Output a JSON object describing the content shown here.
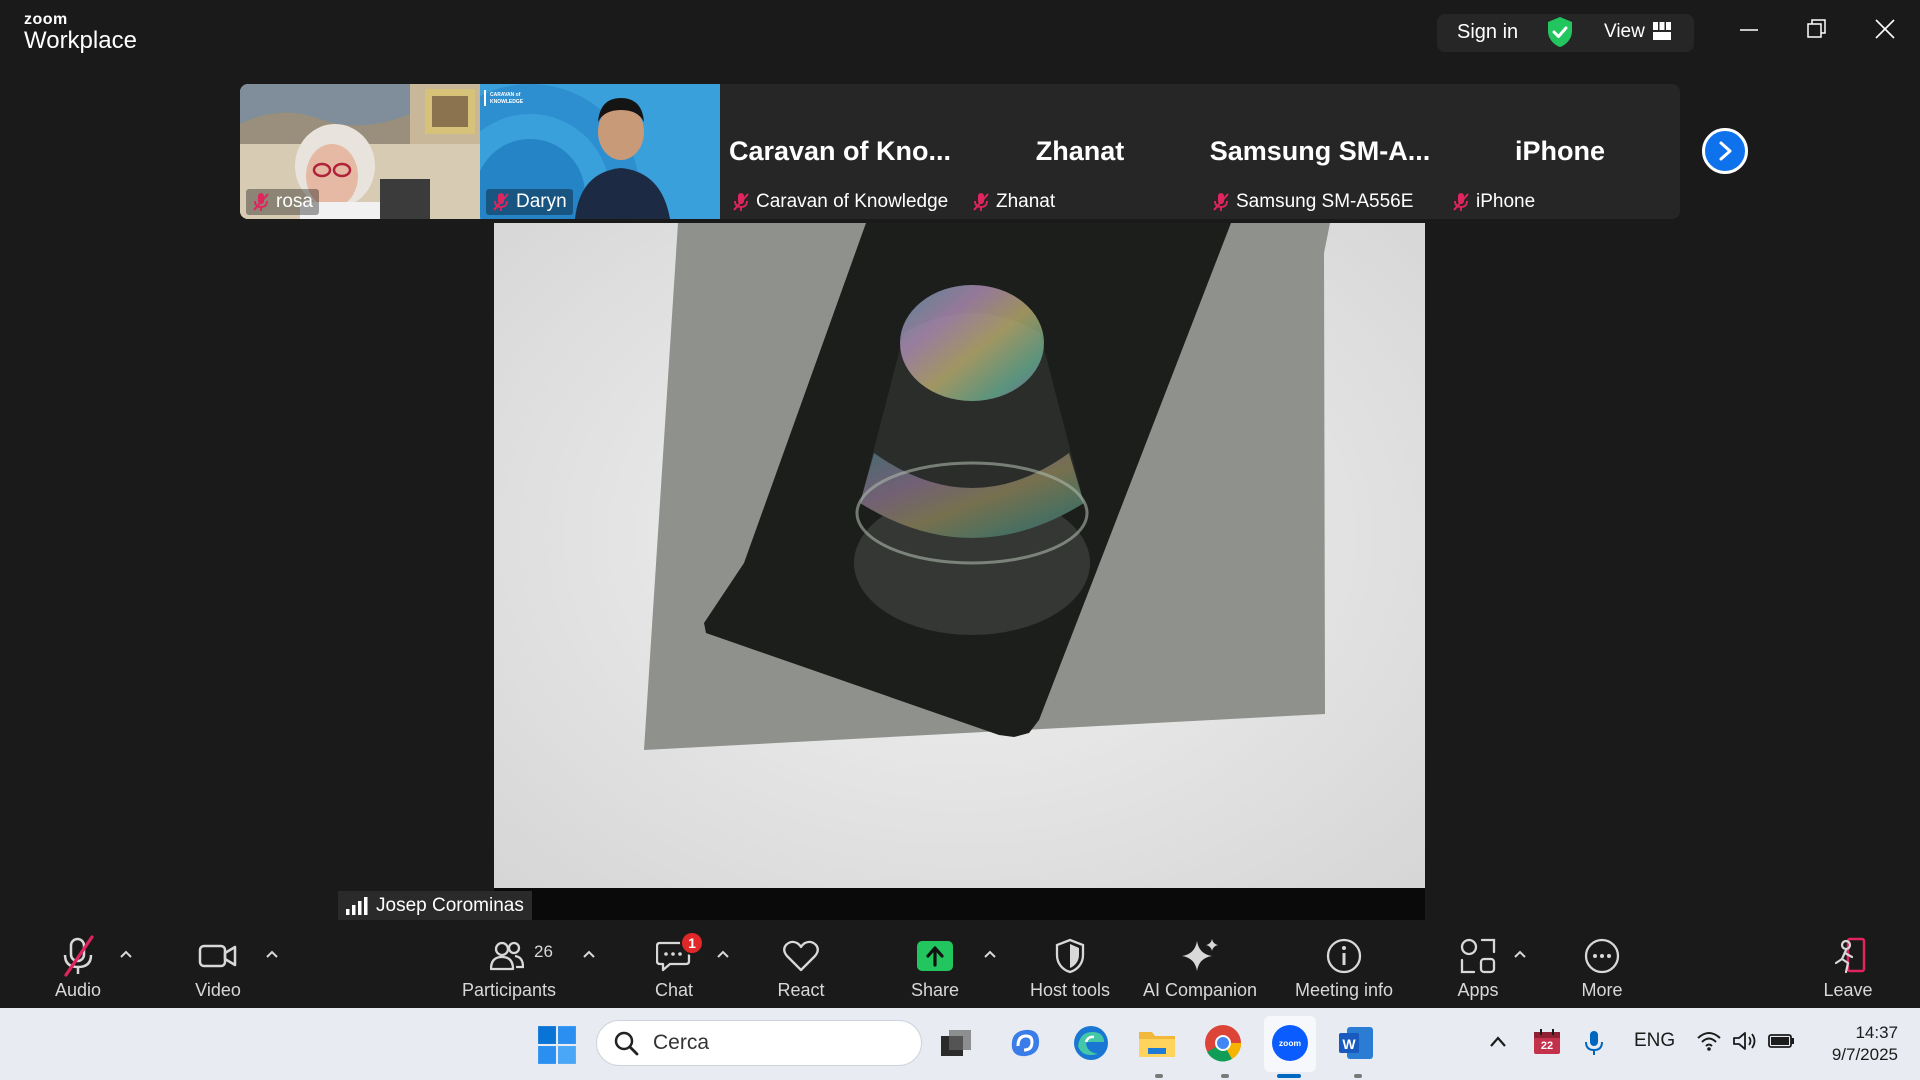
{
  "app": {
    "logo_line1": "zoom",
    "logo_line2": "Workplace",
    "sign_in": "Sign in",
    "view": "View"
  },
  "participants_strip": [
    {
      "name": "rosa",
      "type": "video",
      "muted": true
    },
    {
      "name": "Daryn",
      "type": "video",
      "muted": true,
      "background_text": "CARAVAN of KNOWLEDGE"
    },
    {
      "name": "Caravan of Knowledge",
      "display": "Caravan  of  Kno...",
      "muted": true
    },
    {
      "name": "Zhanat",
      "display": "Zhanat",
      "muted": true
    },
    {
      "name": "Samsung SM-A556E",
      "display": "Samsung  SM-A...",
      "muted": true
    },
    {
      "name": "iPhone",
      "display": "iPhone",
      "muted": true
    }
  ],
  "main_speaker": {
    "name": "Josep Corominas"
  },
  "toolbar": {
    "audio": "Audio",
    "video": "Video",
    "participants": "Participants",
    "participants_count": "26",
    "chat": "Chat",
    "chat_badge": "1",
    "react": "React",
    "share": "Share",
    "host_tools": "Host tools",
    "ai_companion": "AI Companion",
    "meeting_info": "Meeting info",
    "apps": "Apps",
    "more": "More",
    "leave": "Leave"
  },
  "taskbar": {
    "search_placeholder": "Cerca",
    "calendar_day": "22",
    "language": "ENG",
    "time": "14:37",
    "date": "9/7/2025"
  },
  "colors": {
    "accent_blue": "#0e72ed",
    "share_green": "#22c55e",
    "mute_red": "#e0245e",
    "shield_green": "#22c55e"
  }
}
